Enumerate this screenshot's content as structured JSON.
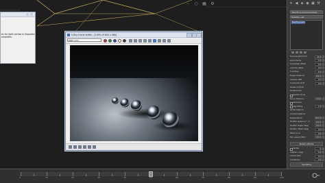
{
  "dialog": {
    "lines": [
      "es for light caches in Separate",
      "ompletes."
    ]
  },
  "framebuffer": {
    "title": "V-Ray frame buffer - [100% of 640 x 480]",
    "channel": "RGB color"
  },
  "panel": {
    "object_name": "VRayPhysicalCamera001",
    "modifier_list_label": "Modifier List",
    "stack_item": "VRayPhysicalCamera",
    "rows": [
      {
        "label": "focal length (mm)",
        "value": "40.0",
        "check": false
      },
      {
        "label": "zoom factor",
        "value": "1.0",
        "check": false
      },
      {
        "label": "horizontal offset",
        "value": "0.0",
        "check": false
      },
      {
        "label": "vertical offset",
        "value": "0.0",
        "check": false
      },
      {
        "label": "f-number",
        "value": "8.0",
        "check": false
      },
      {
        "label": "target distance",
        "value": "200.0",
        "check": false
      },
      {
        "label": "vertical shift",
        "value": "0.0",
        "check": false
      },
      {
        "label": "horizontal shift",
        "value": "0.0",
        "check": false
      },
      {
        "label": "Guess vertical",
        "value": "",
        "check": false
      },
      {
        "label": "Guess horiz.",
        "value": "",
        "check": false
      },
      {
        "label": "specify focus",
        "value": "",
        "check": true
      },
      {
        "label": "focus distance",
        "value": "200.0",
        "check": false
      },
      {
        "label": "exposure",
        "value": "",
        "check": true
      },
      {
        "label": "vignetting",
        "value": "1.0",
        "check": true
      },
      {
        "label": "white balance",
        "value": "",
        "check": false
      },
      {
        "label": "custom balance",
        "value": "",
        "check": false
      },
      {
        "label": "temperature",
        "value": "6500.0",
        "check": false
      },
      {
        "label": "shutter speed (s^-1)",
        "value": "200.0",
        "check": false
      },
      {
        "label": "shutter angle (deg)",
        "value": "180.0",
        "check": false
      },
      {
        "label": "shutter offset (deg)",
        "value": "0.0",
        "check": false
      },
      {
        "label": "latency (s)",
        "value": "0.0",
        "check": false
      },
      {
        "label": "film speed (ISO)",
        "value": "100.0",
        "check": false
      }
    ],
    "section_bokeh": "Bokeh effects",
    "section_sampling": "Sampling",
    "bokeh_rows": [
      {
        "label": "blades",
        "value": "5",
        "check": true
      },
      {
        "label": "rotation (deg)",
        "value": "0.0",
        "check": false
      },
      {
        "label": "center bias",
        "value": "0.0",
        "check": false
      },
      {
        "label": "anisotropy",
        "value": "0.0",
        "check": false
      }
    ],
    "sampling_rows": [
      {
        "label": "depth-of-field",
        "value": "",
        "check": true
      },
      {
        "label": "motion blur",
        "value": "",
        "check": false
      },
      {
        "label": "subdivs",
        "value": "6",
        "check": false
      }
    ]
  },
  "timeline": {
    "labels": [
      "0",
      "10",
      "20",
      "30",
      "40",
      "50",
      "60",
      "70",
      "80",
      "90",
      "100"
    ],
    "current_frame": 50
  }
}
